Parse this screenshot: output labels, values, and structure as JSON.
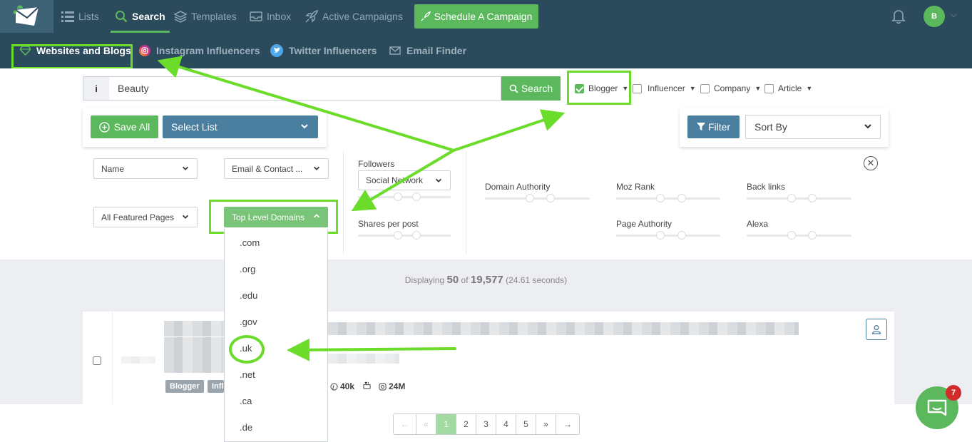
{
  "nav": {
    "lists": "Lists",
    "search": "Search",
    "templates": "Templates",
    "inbox": "Inbox",
    "active_campaigns": "Active Campaigns",
    "schedule_campaign": "Schedule A Campaign",
    "avatar_initial": "B"
  },
  "subnav": {
    "websites_blogs": "Websites and Blogs",
    "instagram": "Instagram Influencers",
    "twitter": "Twitter Influencers",
    "email_finder": "Email Finder"
  },
  "search": {
    "value": "Beauty",
    "button": "Search",
    "types": [
      {
        "label": "Blogger",
        "checked": true
      },
      {
        "label": "Influencer",
        "checked": false
      },
      {
        "label": "Company",
        "checked": false
      },
      {
        "label": "Article",
        "checked": false
      }
    ]
  },
  "actions": {
    "save_all": "Save All",
    "select_list": "Select List",
    "filter": "Filter",
    "sort_by": "Sort By"
  },
  "filters": {
    "name": "Name",
    "email_contact": "Email & Contact ...",
    "featured_pages": "All Featured Pages",
    "top_level_domains": "Top Level Domains",
    "followers": "Followers",
    "social_network": "Social Network",
    "shares_per_post": "Shares per post",
    "domain_authority": "Domain Authority",
    "moz_rank": "Moz Rank",
    "back_links": "Back links",
    "page_authority": "Page Authority",
    "alexa": "Alexa"
  },
  "tld_options": [
    ".com",
    ".org",
    ".edu",
    ".gov",
    ".uk",
    ".net",
    ".ca",
    ".de"
  ],
  "results": {
    "displaying": "Displaying",
    "shown": "50",
    "of": "of",
    "total": "19,577",
    "time": "(24.61 seconds)",
    "tag_blogger": "Blogger",
    "tag_influencer": "Infl",
    "pinterest_count": "40k",
    "instagram_count": "24M"
  },
  "pagination": [
    "←",
    "«",
    "1",
    "2",
    "3",
    "4",
    "5",
    "»",
    "→"
  ],
  "chat_badge": "7",
  "colors": {
    "nav_bg": "#2b4a5c",
    "accent_green": "#5cb85c",
    "accent_blue": "#4a7fa0",
    "highlight": "#6bdc2a"
  }
}
